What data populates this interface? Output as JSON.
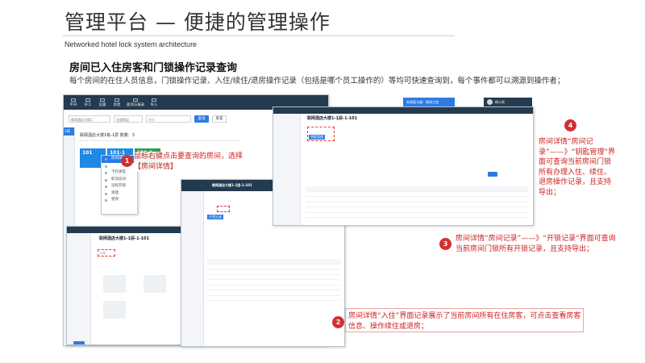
{
  "slide": {
    "title": "管理平台 — 便捷的管理操作",
    "subtitle": "Networked hotel lock system architecture",
    "section_heading": "房间已入住房客和门锁操作记录查询",
    "section_desc": "每个房间的在住人员信息，门锁操作记录、入住/续住/退房操作记录（包括是哪个员工操作的）等均可快速查询到，每个事件都可以溯源到操作者；"
  },
  "main_window": {
    "nav": [
      "平开",
      "开工",
      "设置",
      "房屋",
      "查询与报表",
      "导入"
    ],
    "filter_building": "联网酒店大楼1",
    "filter_floor": "全部楼层",
    "filter_room_placeholder": "房间",
    "btn_search": "查询",
    "btn_reset": "重置",
    "tree_label": "1栋",
    "building_row": "联网酒店大楼1栋-1层 数量：3",
    "rooms": [
      "101",
      "101-1",
      "101-2"
    ],
    "context_menu": [
      "房间详情",
      "",
      "卡控通电",
      "取消房间",
      "远程开锁",
      "清理",
      "更改"
    ],
    "top_right_user": "杨小男",
    "top_right_btn": "系统值卡器：联网工程"
  },
  "detail_windows": {
    "room_title": "联网酒店大楼1-1层-1-101",
    "tabs": [
      "入住",
      "房间记录",
      "钥匙管理",
      "开锁记录"
    ],
    "export_label": "导出"
  },
  "annotations": [
    {
      "num": "1",
      "text": "鼠标右键点击要查询的房间，选择【房间详情】"
    },
    {
      "num": "2",
      "text": "房间详情“入住”界面记录展示了当前房间所有在住房客，可点击查看房客信息、操作续住或退房；"
    },
    {
      "num": "3",
      "text": "房间详情“房间记录”——》“开锁记录”界面可查询当前房间门锁所有开锁记录，且支持导出；"
    },
    {
      "num": "4",
      "text": "房间详情“房间记录”——》“钥匙管理”界面可查询当前房间门锁所有办理入住、续住、退房操作记录，且支持导出；"
    }
  ],
  "colors": {
    "accent": "#2c7be5",
    "topbar": "#243a4e",
    "annotation": "#cc1f1f"
  }
}
